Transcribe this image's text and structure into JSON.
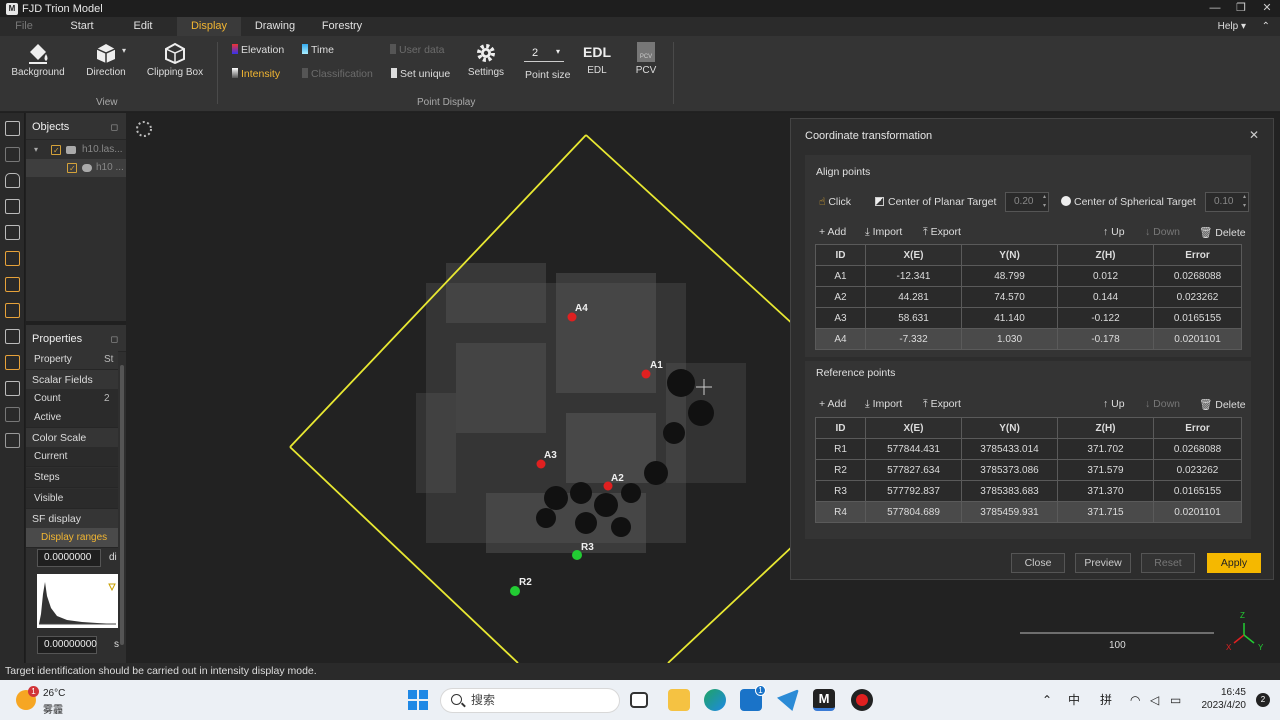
{
  "app": {
    "title": "FJD Trion Model",
    "logo_text": "M"
  },
  "window_controls": {
    "minimize": "—",
    "restore": "❐",
    "close": "✕"
  },
  "menu": {
    "items": [
      {
        "label": "File"
      },
      {
        "label": "Start"
      },
      {
        "label": "Edit"
      },
      {
        "label": "Display"
      },
      {
        "label": "Drawing"
      },
      {
        "label": "Forestry"
      }
    ],
    "active": "Display",
    "help": "Help ▾",
    "collapse": "⌃"
  },
  "ribbon": {
    "background": "Background",
    "direction": "Direction",
    "clipping_box": "Clipping Box",
    "view_group": "View",
    "elevation": "Elevation",
    "time": "Time",
    "user_data": "User data",
    "intensity": "Intensity",
    "classification": "Classification",
    "set_unique": "Set unique",
    "settings": "Settings",
    "point_size_value": "2",
    "point_size": "Point size",
    "edl_icon": "EDL",
    "edl": "EDL",
    "pcv_icon": "PCV",
    "pcv": "PCV",
    "point_display_group": "Point Display"
  },
  "objects_panel": {
    "title": "Objects",
    "pin": "◻",
    "items": [
      {
        "label": "h10.las..."
      },
      {
        "label": "h10 ..."
      }
    ]
  },
  "properties_panel": {
    "title": "Properties",
    "pin": "◻",
    "header_property": "Property",
    "header_state": "St",
    "scalar_fields": "Scalar Fields",
    "count": "Count",
    "count_value": "2",
    "active": "Active",
    "color_scale": "Color Scale",
    "current": "Current",
    "steps": "Steps",
    "visible": "Visible",
    "sf_display_params": "SF display params",
    "display_ranges": "Display ranges",
    "range_min": "0.0000000",
    "range_min_suffix": "di",
    "range_max": "0.00000000",
    "range_max_suffix": "s"
  },
  "viewport": {
    "markers": [
      {
        "label": "A4"
      },
      {
        "label": "A1"
      },
      {
        "label": "A3"
      },
      {
        "label": "A2"
      },
      {
        "label": "R3"
      },
      {
        "label": "R2"
      }
    ],
    "scale_label": "100",
    "axis_z": "Z",
    "axis_x": "X",
    "axis_y": "Y"
  },
  "dialog": {
    "title": "Coordinate transformation",
    "close_icon": "✕",
    "align_points": {
      "title": "Align points",
      "click": "Click",
      "center_planar": "Center of Planar Target",
      "planar_value": "0.20",
      "center_spherical": "Center of Spherical Target",
      "spherical_value": "0.10",
      "add": "Add",
      "import": "Import",
      "export": "Export",
      "up": "Up",
      "down": "Down",
      "delete": "Delete",
      "columns": [
        "ID",
        "X(E)",
        "Y(N)",
        "Z(H)",
        "Error"
      ],
      "rows": [
        [
          "A1",
          "-12.341",
          "48.799",
          "0.012",
          "0.0268088"
        ],
        [
          "A2",
          "44.281",
          "74.570",
          "0.144",
          "0.023262"
        ],
        [
          "A3",
          "58.631",
          "41.140",
          "-0.122",
          "0.0165155"
        ],
        [
          "A4",
          "-7.332",
          "1.030",
          "-0.178",
          "0.0201101"
        ]
      ]
    },
    "reference_points": {
      "title": "Reference points",
      "add": "Add",
      "import": "Import",
      "export": "Export",
      "up": "Up",
      "down": "Down",
      "delete": "Delete",
      "columns": [
        "ID",
        "X(E)",
        "Y(N)",
        "Z(H)",
        "Error"
      ],
      "rows": [
        [
          "R1",
          "577844.431",
          "3785433.014",
          "371.702",
          "0.0268088"
        ],
        [
          "R2",
          "577827.634",
          "3785373.086",
          "371.579",
          "0.023262"
        ],
        [
          "R3",
          "577792.837",
          "3785383.683",
          "371.370",
          "0.0165155"
        ],
        [
          "R4",
          "577804.689",
          "3785459.931",
          "371.715",
          "0.0201101"
        ]
      ]
    },
    "buttons": {
      "close": "Close",
      "preview": "Preview",
      "reset": "Reset",
      "apply": "Apply"
    }
  },
  "status": {
    "message": "Target identification should be carried out in intensity display mode."
  },
  "taskbar": {
    "weather_badge": "1",
    "temperature": "26°C",
    "condition": "雾霾",
    "search_placeholder": "搜索",
    "app_badge": "1",
    "tray_chevron": "⌃",
    "tray_ime": "中",
    "tray_ime2": "拼",
    "time": "16:45",
    "date": "2023/4/20",
    "notification_count": "2"
  },
  "colors": {
    "accent": "#f2b632",
    "apply": "#f5b800",
    "align_marker": "#e02020",
    "ref_marker": "#22cc33",
    "frame": "#e8e832"
  }
}
